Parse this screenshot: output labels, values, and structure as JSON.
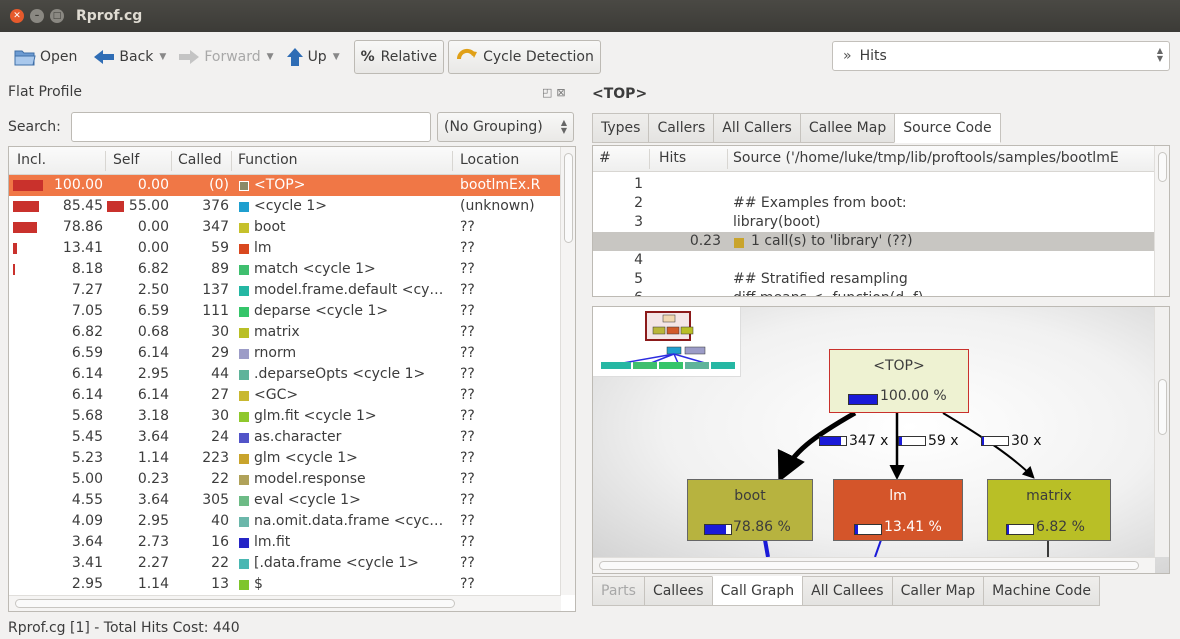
{
  "window": {
    "title": "Rprof.cg"
  },
  "toolbar": {
    "open": "Open",
    "back": "Back",
    "forward": "Forward",
    "up": "Up",
    "relative": "Relative",
    "cycle_detection": "Cycle Detection",
    "cost_chevron": "»",
    "cost_type": "Hits"
  },
  "flat_profile": {
    "title": "Flat Profile",
    "search_label": "Search:",
    "search_value": "",
    "grouping": "(No Grouping)",
    "columns": [
      "Incl.",
      "Self",
      "Called",
      "Function",
      "Location"
    ],
    "rows": [
      {
        "incl": "100.00",
        "self": "0.00",
        "called": "(0)",
        "func": "<TOP>",
        "loc": "bootlmEx.R",
        "color": "#8b8a68",
        "incl_frac": 1.0,
        "self_frac": 0.0,
        "selected": true
      },
      {
        "incl": "85.45",
        "self": "55.00",
        "called": "376",
        "func": "<cycle 1>",
        "loc": "(unknown)",
        "color": "#1f9fcf",
        "incl_frac": 0.8545,
        "self_frac": 0.55
      },
      {
        "incl": "78.86",
        "self": "0.00",
        "called": "347",
        "func": "boot",
        "loc": "??",
        "color": "#c6c12c",
        "incl_frac": 0.7886,
        "self_frac": 0.0
      },
      {
        "incl": "13.41",
        "self": "0.00",
        "called": "59",
        "func": "lm",
        "loc": "??",
        "color": "#d9481f",
        "incl_frac": 0.1341,
        "self_frac": 0.0
      },
      {
        "incl": "8.18",
        "self": "6.82",
        "called": "89",
        "func": "match <cycle 1>",
        "loc": "??",
        "color": "#3fbf6f",
        "incl_frac": 0.0818,
        "self_frac": 0.0
      },
      {
        "incl": "7.27",
        "self": "2.50",
        "called": "137",
        "func": "model.frame.default <cy…",
        "loc": "??",
        "color": "#25b7a3",
        "incl_frac": 0,
        "self_frac": 0
      },
      {
        "incl": "7.05",
        "self": "6.59",
        "called": "111",
        "func": "deparse <cycle 1>",
        "loc": "??",
        "color": "#35c56a",
        "incl_frac": 0,
        "self_frac": 0
      },
      {
        "incl": "6.82",
        "self": "0.68",
        "called": "30",
        "func": "matrix",
        "loc": "??",
        "color": "#b9bf26",
        "incl_frac": 0,
        "self_frac": 0
      },
      {
        "incl": "6.59",
        "self": "6.14",
        "called": "29",
        "func": "rnorm",
        "loc": "??",
        "color": "#9c9cc7",
        "incl_frac": 0,
        "self_frac": 0
      },
      {
        "incl": "6.14",
        "self": "2.95",
        "called": "44",
        "func": ".deparseOpts <cycle 1>",
        "loc": "??",
        "color": "#5fb39a",
        "incl_frac": 0,
        "self_frac": 0
      },
      {
        "incl": "6.14",
        "self": "6.14",
        "called": "27",
        "func": "<GC>",
        "loc": "??",
        "color": "#c8b830",
        "incl_frac": 0,
        "self_frac": 0
      },
      {
        "incl": "5.68",
        "self": "3.18",
        "called": "30",
        "func": "glm.fit <cycle 1>",
        "loc": "??",
        "color": "#8fc82c",
        "incl_frac": 0,
        "self_frac": 0
      },
      {
        "incl": "5.45",
        "self": "3.64",
        "called": "24",
        "func": "as.character",
        "loc": "??",
        "color": "#5254c8",
        "incl_frac": 0,
        "self_frac": 0
      },
      {
        "incl": "5.23",
        "self": "1.14",
        "called": "223",
        "func": "glm <cycle 1>",
        "loc": "??",
        "color": "#c9a42c",
        "incl_frac": 0,
        "self_frac": 0
      },
      {
        "incl": "5.00",
        "self": "0.23",
        "called": "22",
        "func": "model.response",
        "loc": "??",
        "color": "#b0a25a",
        "incl_frac": 0,
        "self_frac": 0
      },
      {
        "incl": "4.55",
        "self": "3.64",
        "called": "305",
        "func": "eval <cycle 1>",
        "loc": "??",
        "color": "#6dbb86",
        "incl_frac": 0,
        "self_frac": 0
      },
      {
        "incl": "4.09",
        "self": "2.95",
        "called": "40",
        "func": "na.omit.data.frame <cyc…",
        "loc": "??",
        "color": "#6bb7aa",
        "incl_frac": 0,
        "self_frac": 0
      },
      {
        "incl": "3.64",
        "self": "2.73",
        "called": "16",
        "func": "lm.fit",
        "loc": "??",
        "color": "#2525c6",
        "incl_frac": 0,
        "self_frac": 0
      },
      {
        "incl": "3.41",
        "self": "2.27",
        "called": "22",
        "func": "[.data.frame <cycle 1>",
        "loc": "??",
        "color": "#49b7b2",
        "incl_frac": 0,
        "self_frac": 0
      },
      {
        "incl": "2.95",
        "self": "1.14",
        "called": "13",
        "func": "$",
        "loc": "??",
        "color": "#7ec52c",
        "incl_frac": 0,
        "self_frac": 0
      }
    ]
  },
  "detail": {
    "function_label": "<TOP>",
    "top_tabs": [
      "Types",
      "Callers",
      "All Callers",
      "Callee Map",
      "Source Code"
    ],
    "top_active": 4,
    "source_columns": [
      "#",
      "Hits",
      "Source ('/home/luke/tmp/lib/proftools/samples/bootlmE"
    ],
    "source_lines": [
      {
        "n": "1",
        "hits": "",
        "text": ""
      },
      {
        "n": "2",
        "hits": "",
        "text": "## Examples from boot:"
      },
      {
        "n": "3",
        "hits": "",
        "text": "library(boot)"
      },
      {
        "n": "",
        "hits": "0.23",
        "text": "1 call(s) to 'library' (??)",
        "highlight": true
      },
      {
        "n": "4",
        "hits": "",
        "text": ""
      },
      {
        "n": "5",
        "hits": "",
        "text": "## Stratified resampling"
      },
      {
        "n": "6",
        "hits": "",
        "text": "diff.means <- function(d, f)"
      }
    ],
    "graph": {
      "top": {
        "label": "<TOP>",
        "pct": "100.00 %",
        "frac": 1.0
      },
      "children": [
        {
          "label": "boot",
          "pct": "78.86 %",
          "frac": 0.7886,
          "calls": "347 x",
          "color": "#b9b63a"
        },
        {
          "label": "lm",
          "pct": "13.41 %",
          "frac": 0.1341,
          "calls": "59 x",
          "color": "#d25a2a"
        },
        {
          "label": "matrix",
          "pct": "6.82 %",
          "frac": 0.0682,
          "calls": "30 x",
          "color": "#b9bf26"
        }
      ]
    },
    "bottom_tabs": [
      "Parts",
      "Callees",
      "Call Graph",
      "All Callees",
      "Caller Map",
      "Machine Code"
    ],
    "bottom_active": 2
  },
  "status": "Rprof.cg [1] - Total Hits Cost: 440"
}
